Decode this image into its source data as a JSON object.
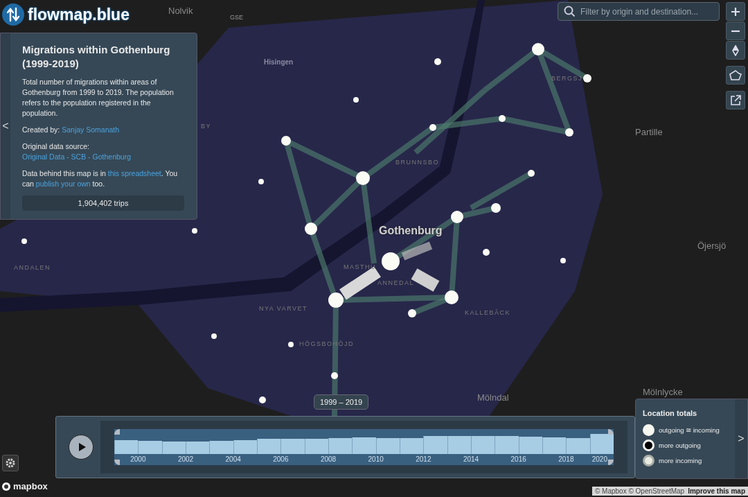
{
  "logo": "flowmap.blue",
  "map_labels": [
    {
      "text": "Nolvik",
      "kind": "town"
    },
    {
      "text": "GSE",
      "kind": "small"
    },
    {
      "text": "Hisingen",
      "kind": "area"
    },
    {
      "text": "BERGSJ",
      "kind": "district"
    },
    {
      "text": "Partille",
      "kind": "town"
    },
    {
      "text": "BY",
      "kind": "district"
    },
    {
      "text": "BRUNNSBO",
      "kind": "district"
    },
    {
      "text": "Gothenburg",
      "kind": "city"
    },
    {
      "text": "ANDALEN",
      "kind": "district"
    },
    {
      "text": "Öjersjö",
      "kind": "town"
    },
    {
      "text": "MASTHU",
      "kind": "district"
    },
    {
      "text": "ANNEDAL",
      "kind": "district"
    },
    {
      "text": "NYA VARVET",
      "kind": "district"
    },
    {
      "text": "KALLEBÄCK",
      "kind": "district"
    },
    {
      "text": "HÖGSBOHÖJD",
      "kind": "district"
    },
    {
      "text": "Mölndal",
      "kind": "town"
    },
    {
      "text": "Mölnlycke",
      "kind": "town"
    }
  ],
  "info": {
    "collapse": "<",
    "title": "Migrations within Gothenburg (1999-2019)",
    "description": "Total number of migrations within areas of Gothenburg from 1999 to 2019. The population refers to the population registered in the population.",
    "created_by": {
      "label": "Created by:",
      "link": "Sanjay Somanath"
    },
    "source": {
      "label": "Original data source:",
      "link": "Original Data - SCB - Gothenburg"
    },
    "data_note": {
      "before": "Data behind this map is in",
      "link": "this spreadsheet",
      "middle": ". You can",
      "link_2": "publish your own",
      "after": "too."
    },
    "total": "1,904,402 trips"
  },
  "search": {
    "placeholder": "Filter by origin and destination..."
  },
  "timeline": {
    "range": "1999 – 2019",
    "years": [
      "2000",
      "2002",
      "2004",
      "2006",
      "2008",
      "2010",
      "2012",
      "2014",
      "2016",
      "2018",
      "2020"
    ]
  },
  "legend": {
    "title": "Location totals",
    "expand": ">",
    "items": [
      {
        "kind": "equal",
        "label": "outgoing ≅ incoming"
      },
      {
        "kind": "outgoing",
        "label": "more outgoing"
      },
      {
        "kind": "incoming",
        "label": "more incoming"
      }
    ]
  },
  "mapbox_logo": "mapbox",
  "attribution": {
    "text": "© Mapbox © OpenStreetMap",
    "link": "Improve this map"
  }
}
